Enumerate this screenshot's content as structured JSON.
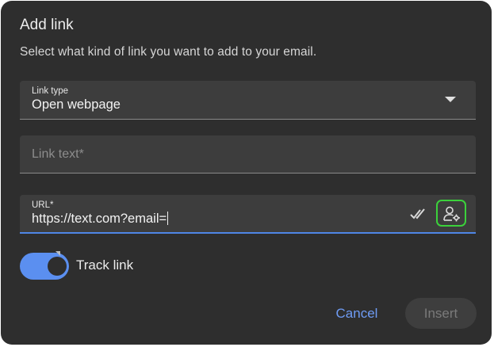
{
  "dialog": {
    "title": "Add link",
    "subtitle": "Select what kind of link you want to add to your email."
  },
  "fields": {
    "link_type": {
      "label": "Link type",
      "value": "Open webpage",
      "icon": "chevron-down-icon"
    },
    "link_text": {
      "placeholder": "Link text*",
      "value": ""
    },
    "url": {
      "label": "URL*",
      "value": "https://text.com?email=",
      "icons": [
        "double-check-icon",
        "personalize-icon"
      ]
    }
  },
  "track_link": {
    "label": "Track link",
    "enabled": true
  },
  "actions": {
    "cancel_label": "Cancel",
    "insert_label": "Insert"
  },
  "colors": {
    "background": "#2e2e2e",
    "field": "#3d3d3d",
    "accent": "#5b8ff0",
    "focus_highlight": "#3bd13b"
  }
}
